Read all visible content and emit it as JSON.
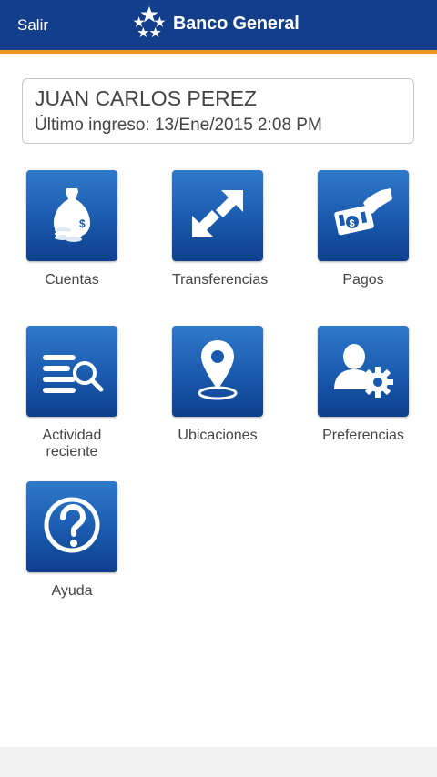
{
  "header": {
    "logout_label": "Salir",
    "brand_name": "Banco General",
    "logo_icon": "star-cluster-icon",
    "colors": {
      "bar": "#123e8c",
      "stripe": "#f0951f"
    }
  },
  "user": {
    "name": "JUAN CARLOS PEREZ",
    "last_login": "Último ingreso: 13/Ene/2015 2:08 PM"
  },
  "menu": [
    {
      "label": "Cuentas",
      "icon": "money-bag-icon"
    },
    {
      "label": "Transferencias",
      "icon": "transfer-arrows-icon"
    },
    {
      "label": "Pagos",
      "icon": "hand-payment-icon"
    },
    {
      "label": "Actividad reciente",
      "icon": "activity-search-icon"
    },
    {
      "label": "Ubicaciones",
      "icon": "location-pin-icon"
    },
    {
      "label": "Preferencias",
      "icon": "user-settings-icon"
    },
    {
      "label": "Ayuda",
      "icon": "help-icon"
    }
  ]
}
